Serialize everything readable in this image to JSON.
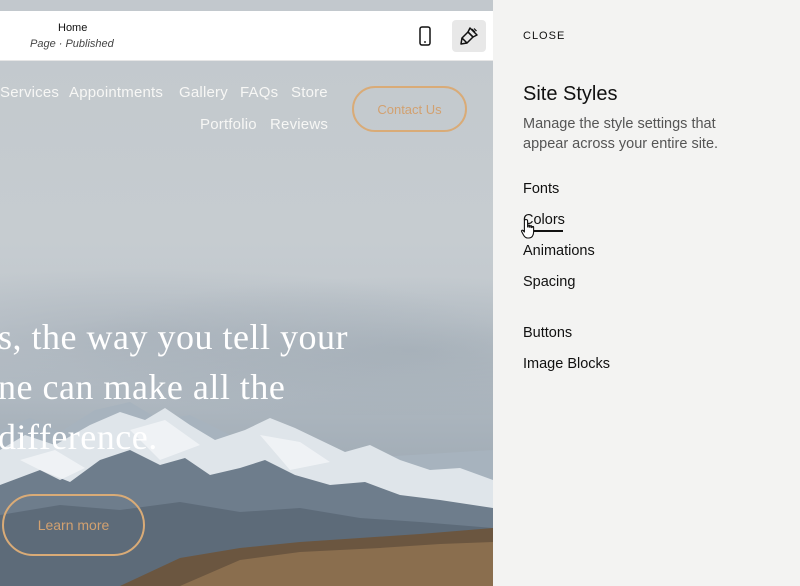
{
  "topbar": {
    "page_title": "Home",
    "page_status": "Page · Published"
  },
  "site_nav": {
    "items": [
      "Services",
      "Appointments",
      "Gallery",
      "FAQs",
      "Store",
      "Portfolio",
      "Reviews"
    ],
    "contact_label": "Contact Us"
  },
  "hero": {
    "lines": [
      "s, the way you tell your",
      "ne can make all the",
      "difference."
    ],
    "button_label": "Learn more"
  },
  "panel": {
    "close_label": "CLOSE",
    "title": "Site Styles",
    "description": "Manage the style settings that appear across your entire site.",
    "menu": [
      "Fonts",
      "Colors",
      "Animations",
      "Spacing",
      "Buttons",
      "Image Blocks"
    ],
    "hovered_item": "Colors"
  },
  "colors": {
    "accent": "#d9ab77",
    "panel_bg": "#f3f3f2"
  },
  "icons": {
    "mobile": "mobile-phone-icon",
    "style": "paintbrush-icon",
    "cursor": "hand-pointer-icon"
  }
}
